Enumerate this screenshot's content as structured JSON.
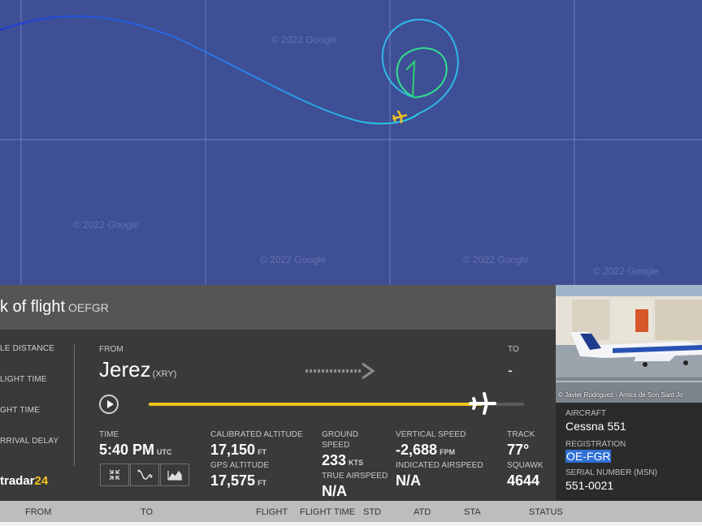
{
  "map": {
    "watermark": "© 2022 Google",
    "track_colors": {
      "west": "#1c3cd8",
      "middle": "#2a7bea",
      "east": "#27d7e0",
      "loop": "#31e08c",
      "digit": "#2fd174"
    },
    "plane_color": "#f2c21c"
  },
  "panel": {
    "title": "k of flight",
    "title_reg": "OEFGR",
    "left_labels": [
      "LE DISTANCE",
      "LIGHT TIME",
      "GHT TIME",
      "RRIVAL DELAY"
    ],
    "from_label": "FROM",
    "from_city": "Jerez",
    "from_code": "(XRY)",
    "to_label": "TO",
    "to_city": "-",
    "progress": 0.89,
    "time_label": "TIME",
    "time_value": "5:40 PM",
    "time_unit": "UTC",
    "cal_alt_label": "CALIBRATED ALTITUDE",
    "cal_alt_value": "17,150",
    "cal_alt_unit": "FT",
    "gps_alt_label": "GPS ALTITUDE",
    "gps_alt_value": "17,575",
    "gps_alt_unit": "FT",
    "ground_speed_label_1": "GROUND",
    "ground_speed_label_2": "SPEED",
    "ground_speed_value": "233",
    "ground_speed_unit": "KTS",
    "true_airspeed_label": "TRUE AIRSPEED",
    "true_airspeed_value": "N/A",
    "vert_speed_label": "VERTICAL SPEED",
    "vert_speed_value": "-2,688",
    "vert_speed_unit": "FPM",
    "ind_airspeed_label": "INDICATED AIRSPEED",
    "ind_airspeed_value": "N/A",
    "track_label": "TRACK",
    "track_value": "77°",
    "squawk_label": "SQUAWK",
    "squawk_value": "4644",
    "logo_main": "tradar",
    "logo_accent": "24",
    "accent_color": "#f2c21c"
  },
  "side": {
    "photo_credit": "© Javier Rodriguez - Amics de Son Sant Jo",
    "aircraft_label": "AIRCRAFT",
    "aircraft_value": "Cessna 551",
    "registration_label": "REGISTRATION",
    "registration_value": "OE-FGR",
    "serial_label": "SERIAL NUMBER (MSN)",
    "serial_value": "551-0021"
  },
  "table_header": {
    "from": "FROM",
    "to": "TO",
    "flight": "FLIGHT",
    "flight_time": "FLIGHT TIME",
    "std": "STD",
    "atd": "ATD",
    "sta": "STA",
    "status": "STATUS"
  }
}
